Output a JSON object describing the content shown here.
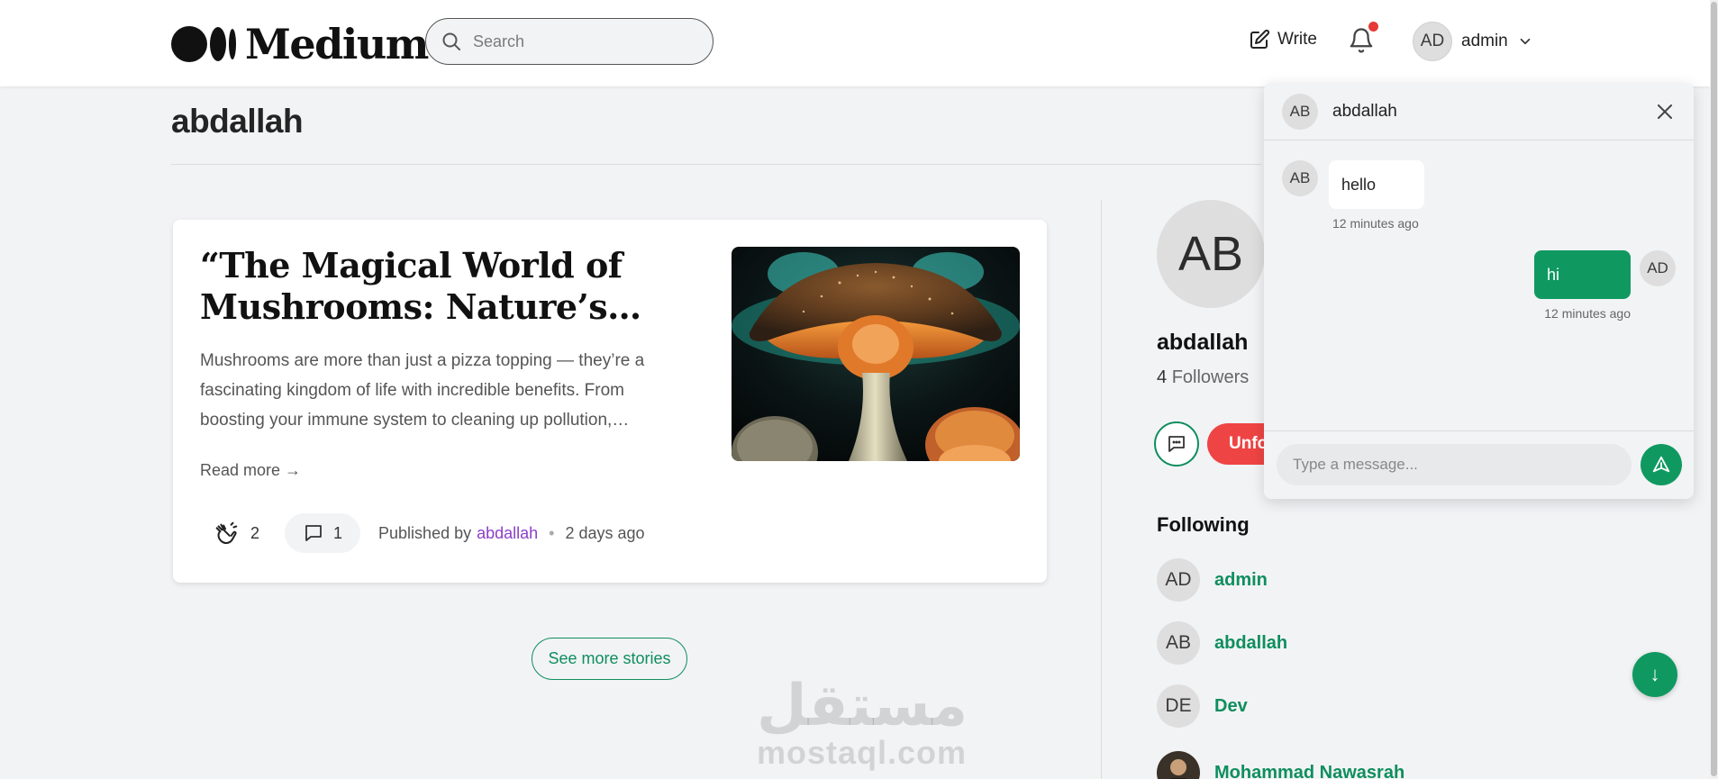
{
  "header": {
    "logo_text": "Medium",
    "search_placeholder": "Search",
    "write_label": "Write",
    "user": {
      "initials": "AD",
      "name": "admin"
    }
  },
  "profile": {
    "title": "abdallah"
  },
  "article": {
    "title": "“The Magical World of Mushrooms: Nature’s…",
    "excerpt": "Mushrooms are more than just a pizza topping — they’re a fascinating kingdom of life with incredible benefits. From boosting your immune system to cleaning up pollution,…",
    "read_more": "Read more →",
    "claps": "2",
    "comments": "1",
    "published_prefix": "Published by",
    "author": "abdallah",
    "separator": "•",
    "time": "2 days ago"
  },
  "see_more_label": "See more stories",
  "watermark": {
    "arabic": "مستقل",
    "latin": "mostaql.com"
  },
  "sidebar": {
    "initials": "AB",
    "name": "abdallah",
    "followers_count": "4",
    "followers_label": "Followers",
    "unfollow_label": "Unfollow",
    "following_title": "Following",
    "following": [
      {
        "initials": "AD",
        "name": "admin"
      },
      {
        "initials": "AB",
        "name": "abdallah"
      },
      {
        "initials": "DE",
        "name": "Dev"
      },
      {
        "initials": "",
        "name": "Mohammad Nawasrah"
      }
    ]
  },
  "chat": {
    "initials": "AB",
    "name": "abdallah",
    "messages": [
      {
        "from": "AB",
        "text": "hello",
        "time": "12 minutes ago"
      },
      {
        "from": "AD",
        "text": "hi",
        "time": "12 minutes ago"
      }
    ],
    "input_placeholder": "Type a message..."
  },
  "scroll_down_label": "↓",
  "colors": {
    "accent": "#0f9960",
    "danger": "#ef4444",
    "author_link": "#8b3fc9",
    "notification_dot": "#e53935"
  }
}
